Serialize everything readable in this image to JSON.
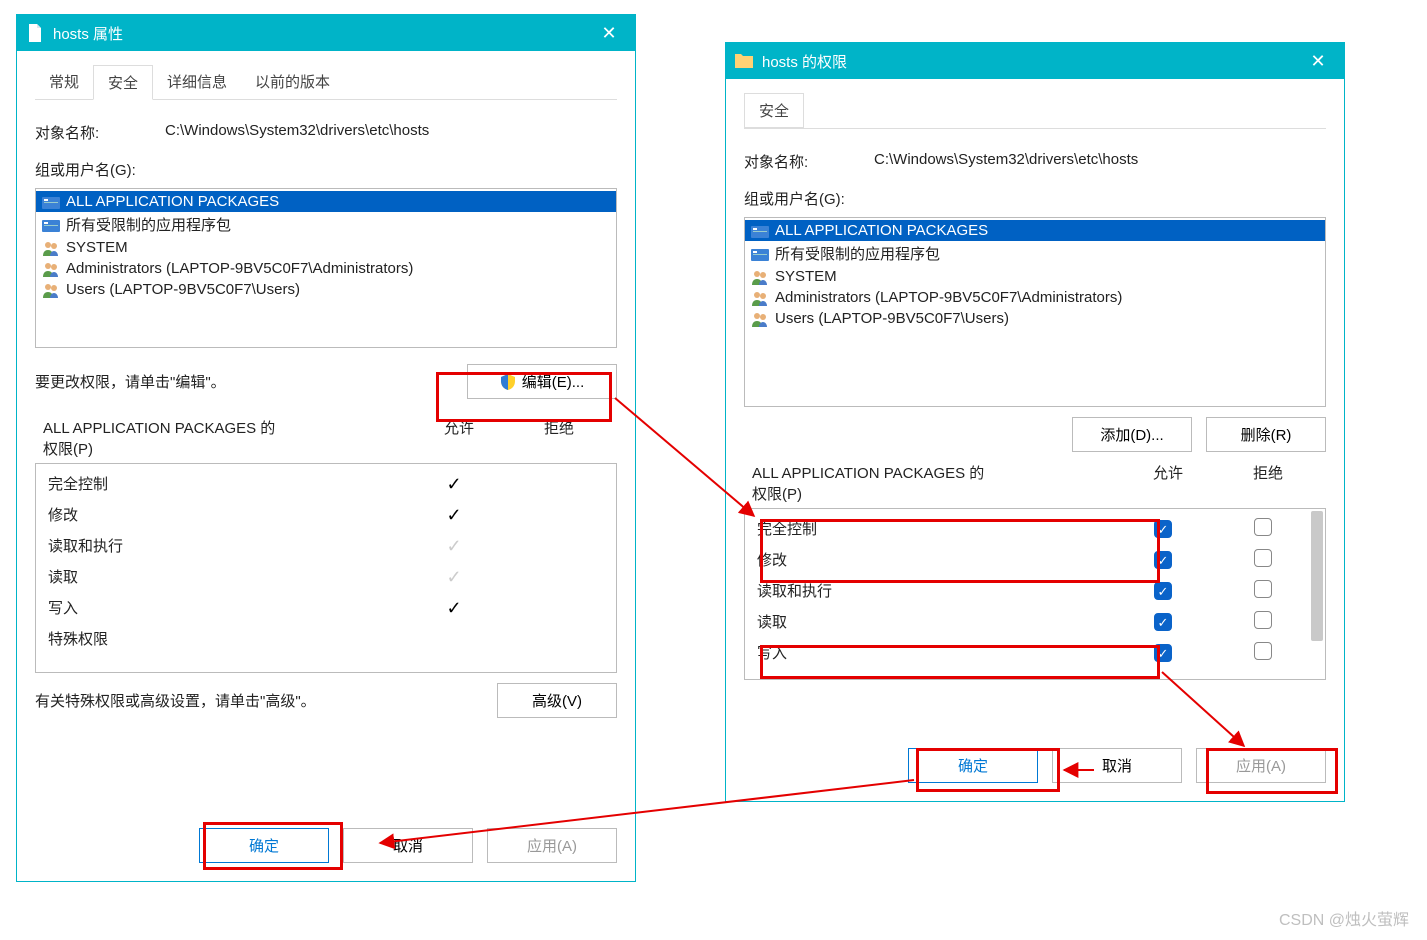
{
  "watermark": "CSDN @烛火萤辉",
  "left": {
    "title": "hosts 属性",
    "tabs": [
      "常规",
      "安全",
      "详细信息",
      "以前的版本"
    ],
    "active_tab": 1,
    "object_label": "对象名称:",
    "object_value": "C:\\Windows\\System32\\drivers\\etc\\hosts",
    "groups_label": "组或用户名(G):",
    "groups": [
      "ALL APPLICATION PACKAGES",
      "所有受限制的应用程序包",
      "SYSTEM",
      "Administrators (LAPTOP-9BV5C0F7\\Administrators)",
      "Users (LAPTOP-9BV5C0F7\\Users)"
    ],
    "edit_hint": "要更改权限，请单击\"编辑\"。",
    "edit_button": "编辑(E)...",
    "perm_title_prefix": "ALL APPLICATION PACKAGES 的",
    "perm_title_line2": "权限(P)",
    "allow_label": "允许",
    "deny_label": "拒绝",
    "perms": [
      {
        "name": "完全控制",
        "allow": true,
        "deny": false,
        "gray": false
      },
      {
        "name": "修改",
        "allow": true,
        "deny": false,
        "gray": false
      },
      {
        "name": "读取和执行",
        "allow": true,
        "deny": false,
        "gray": true
      },
      {
        "name": "读取",
        "allow": true,
        "deny": false,
        "gray": true
      },
      {
        "name": "写入",
        "allow": true,
        "deny": false,
        "gray": false
      },
      {
        "name": "特殊权限",
        "allow": false,
        "deny": false,
        "gray": false
      }
    ],
    "advanced_hint": "有关特殊权限或高级设置，请单击\"高级\"。",
    "advanced_button": "高级(V)",
    "ok": "确定",
    "cancel": "取消",
    "apply": "应用(A)"
  },
  "right": {
    "title": "hosts 的权限",
    "tab": "安全",
    "object_label": "对象名称:",
    "object_value": "C:\\Windows\\System32\\drivers\\etc\\hosts",
    "groups_label": "组或用户名(G):",
    "groups": [
      "ALL APPLICATION PACKAGES",
      "所有受限制的应用程序包",
      "SYSTEM",
      "Administrators (LAPTOP-9BV5C0F7\\Administrators)",
      "Users (LAPTOP-9BV5C0F7\\Users)"
    ],
    "add_button": "添加(D)...",
    "remove_button": "删除(R)",
    "perm_title_prefix": "ALL APPLICATION PACKAGES 的",
    "perm_title_line2": "权限(P)",
    "allow_label": "允许",
    "deny_label": "拒绝",
    "perms": [
      {
        "name": "完全控制",
        "allow": true,
        "deny": false
      },
      {
        "name": "修改",
        "allow": true,
        "deny": false
      },
      {
        "name": "读取和执行",
        "allow": true,
        "deny": false
      },
      {
        "name": "读取",
        "allow": true,
        "deny": false
      },
      {
        "name": "写入",
        "allow": true,
        "deny": false
      }
    ],
    "ok": "确定",
    "cancel": "取消",
    "apply": "应用(A)"
  }
}
